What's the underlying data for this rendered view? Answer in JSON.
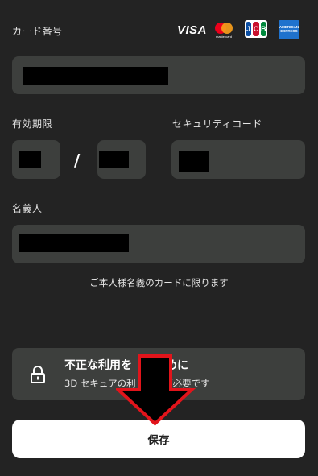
{
  "card_number": {
    "label": "カード番号",
    "value": ""
  },
  "brands": {
    "visa": "VISA",
    "mastercard": "mastercard",
    "jcb": [
      "J",
      "C",
      "B"
    ],
    "amex": "AMERICAN EXPRESS"
  },
  "expiry": {
    "label": "有効期限",
    "separator": "/",
    "month": "",
    "year": ""
  },
  "security_code": {
    "label": "セキュリティコード",
    "value": ""
  },
  "holder": {
    "label": "名義人",
    "value": "",
    "note": "ご本人様名義のカードに限ります"
  },
  "secure_notice": {
    "title": "不正な利用を　　　めに",
    "subtitle": "3D セキュアの利　　　が必要です"
  },
  "save_button": {
    "label": "保存"
  },
  "colors": {
    "background": "#232323",
    "field": "#3d3f3d",
    "annotation_arrow": "#e2141b"
  }
}
